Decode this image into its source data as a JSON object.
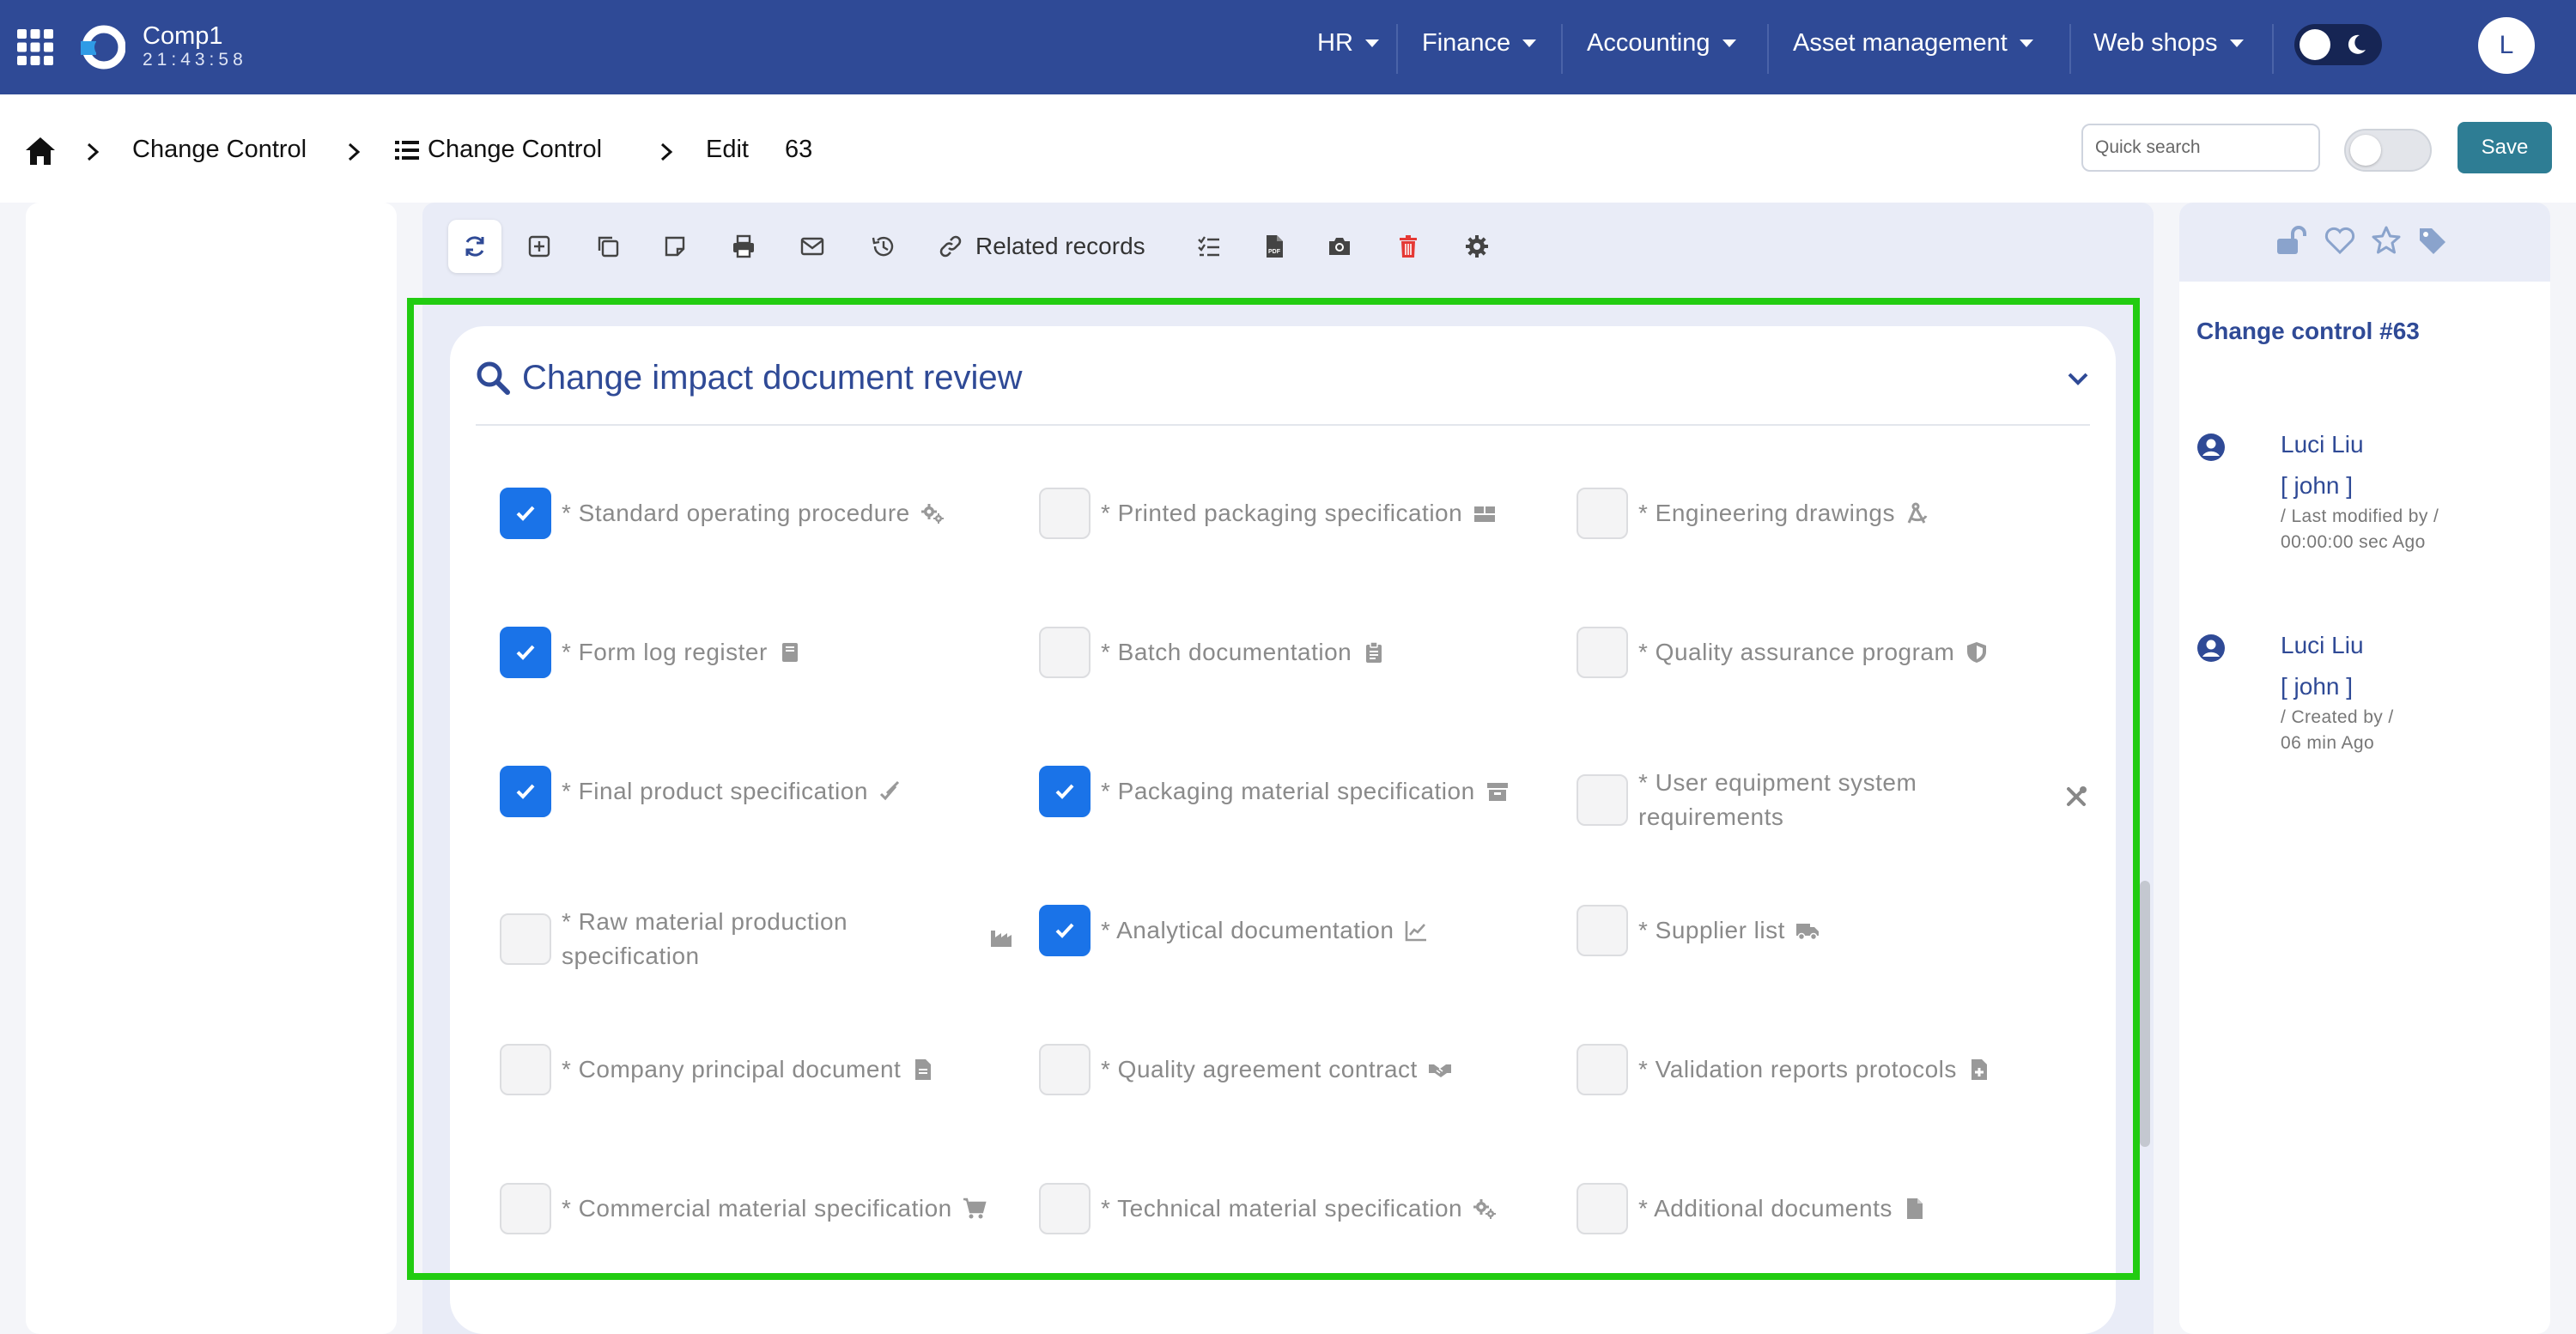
{
  "navbar": {
    "company": "Comp1",
    "clock": "21:43:58",
    "menus": [
      "HR",
      "Finance",
      "Accounting",
      "Asset management",
      "Web shops"
    ],
    "avatar_initial": "L"
  },
  "breadcrumb": {
    "items": [
      "Change Control",
      "Change Control",
      "Edit"
    ],
    "record_id": "63"
  },
  "quick_search": {
    "placeholder": "Quick search",
    "value": ""
  },
  "save_label": "Save",
  "toolbar": {
    "related_records_label": "Related records",
    "buttons": [
      "refresh-icon",
      "add-record-icon",
      "copy-icon",
      "note-icon",
      "print-icon",
      "mail-icon",
      "history-icon",
      "link-icon",
      "checklist-icon",
      "pdf-icon",
      "camera-icon",
      "trash-icon",
      "gear-icon"
    ]
  },
  "section": {
    "title": "Change impact document review",
    "items": [
      {
        "label": "* Standard operating procedure",
        "checked": true,
        "icon": "cogs-icon"
      },
      {
        "label": "* Printed packaging specification",
        "checked": false,
        "icon": "boxes-icon"
      },
      {
        "label": "* Engineering drawings",
        "checked": false,
        "icon": "drafting-compass-icon"
      },
      {
        "label": "* Form log register",
        "checked": true,
        "icon": "book-icon"
      },
      {
        "label": "* Batch documentation",
        "checked": false,
        "icon": "clipboard-icon"
      },
      {
        "label": "* Quality assurance program",
        "checked": false,
        "icon": "shield-icon"
      },
      {
        "label": "* Final product specification",
        "checked": true,
        "icon": "check-double-icon"
      },
      {
        "label": "* Packaging material specification",
        "checked": true,
        "icon": "archive-icon"
      },
      {
        "label": "* User equipment system requirements",
        "checked": false,
        "icon": "tools-icon"
      },
      {
        "label": "* Raw material production specification",
        "checked": false,
        "icon": "industry-icon"
      },
      {
        "label": "* Analytical documentation",
        "checked": true,
        "icon": "chart-line-icon"
      },
      {
        "label": "* Supplier list",
        "checked": false,
        "icon": "truck-icon"
      },
      {
        "label": "* Company principal document",
        "checked": false,
        "icon": "file-icon"
      },
      {
        "label": "* Quality agreement contract",
        "checked": false,
        "icon": "handshake-icon"
      },
      {
        "label": "* Validation reports protocols",
        "checked": false,
        "icon": "file-medical-icon"
      },
      {
        "label": "* Commercial material specification",
        "checked": false,
        "icon": "cart-icon"
      },
      {
        "label": "* Technical material specification",
        "checked": false,
        "icon": "cogs-icon"
      },
      {
        "label": "* Additional documents",
        "checked": false,
        "icon": "file-icon"
      }
    ]
  },
  "right_panel": {
    "title": "Change control #63",
    "icons": [
      "unlock-icon",
      "heart-icon",
      "star-icon",
      "tag-icon"
    ],
    "entries": [
      {
        "name": "Luci Liu",
        "user": "[ john ]",
        "action": "/ Last modified by /",
        "time": "00:00:00 sec Ago"
      },
      {
        "name": "Luci Liu",
        "user": "[ john ]",
        "action": "/ Created by /",
        "time": "06 min Ago"
      }
    ]
  },
  "colors": {
    "navbar": "#2f4a96",
    "accent_text": "#2f4a96",
    "checkbox_checked": "#1a73e8",
    "save_button": "#2e7d94",
    "delete_icon": "#e53935",
    "highlight_border": "#22cc11"
  }
}
